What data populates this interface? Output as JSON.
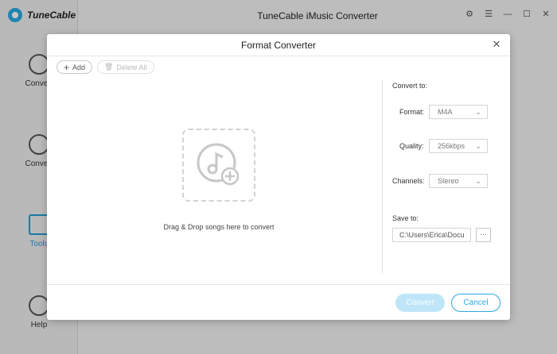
{
  "app": {
    "title": "TuneCable iMusic Converter",
    "logo_text": "TuneCable",
    "sidebar": [
      {
        "label": "Convert"
      },
      {
        "label": "Convert"
      },
      {
        "label": "Tools"
      },
      {
        "label": "Help"
      }
    ]
  },
  "dialog": {
    "title": "Format Converter",
    "toolbar": {
      "add_label": "Add",
      "delete_all_label": "Delete All"
    },
    "drop_text": "Drag & Drop songs here to convert",
    "settings": {
      "convert_to_label": "Convert to:",
      "format_label": "Format:",
      "format_value": "M4A",
      "quality_label": "Quality:",
      "quality_value": "256kbps",
      "channels_label": "Channels:",
      "channels_value": "Stereo",
      "save_to_label": "Save to:",
      "save_path": "C:\\Users\\Erica\\Docu",
      "browse_label": "···"
    },
    "convert_label": "Convert",
    "cancel_label": "Cancel"
  },
  "colors": {
    "accent": "#2aa9e0",
    "convert_disabled": "#bfe6f8"
  }
}
